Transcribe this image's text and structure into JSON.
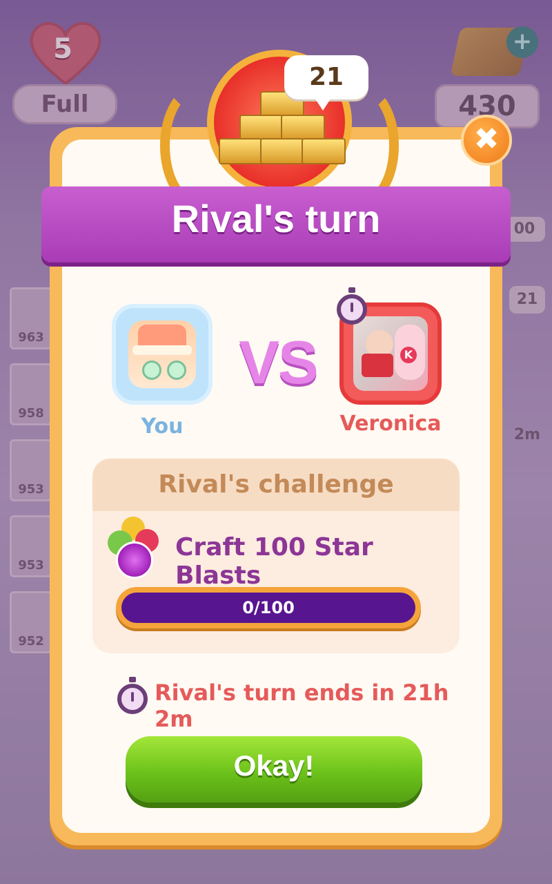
{
  "hud": {
    "lives_count": "5",
    "lives_status": "Full",
    "gold_amount": "430",
    "gold_add": "+"
  },
  "background": {
    "leaderboard_scores": [
      "963",
      "958",
      "953",
      "953",
      "952"
    ],
    "right_labels": [
      "00",
      "21",
      "2m"
    ]
  },
  "modal": {
    "reward_count": "21",
    "title": "Rival's turn",
    "close_glyph": "✖",
    "vs_text": "VS",
    "player_label": "You",
    "rival_name": "Veronica",
    "rival_photo_badge": "K",
    "challenge": {
      "header": "Rival's challenge",
      "task": "Craft 100 Star Blasts",
      "progress_text": "0/100",
      "progress_fraction": 0
    },
    "turn_ends_text": "Rival's turn ends in 21h 2m",
    "confirm_label": "Okay!"
  },
  "colors": {
    "ribbon": "#b249bd",
    "player": "#7ab3e0",
    "rival": "#e55a5a",
    "task": "#8c3696",
    "button": "#6cc21a"
  },
  "icons": [
    "heart-icon",
    "gold-bars-icon",
    "plus-icon",
    "close-icon",
    "trophy-gold-icon",
    "stopwatch-icon",
    "star-blast-gem-icon"
  ]
}
